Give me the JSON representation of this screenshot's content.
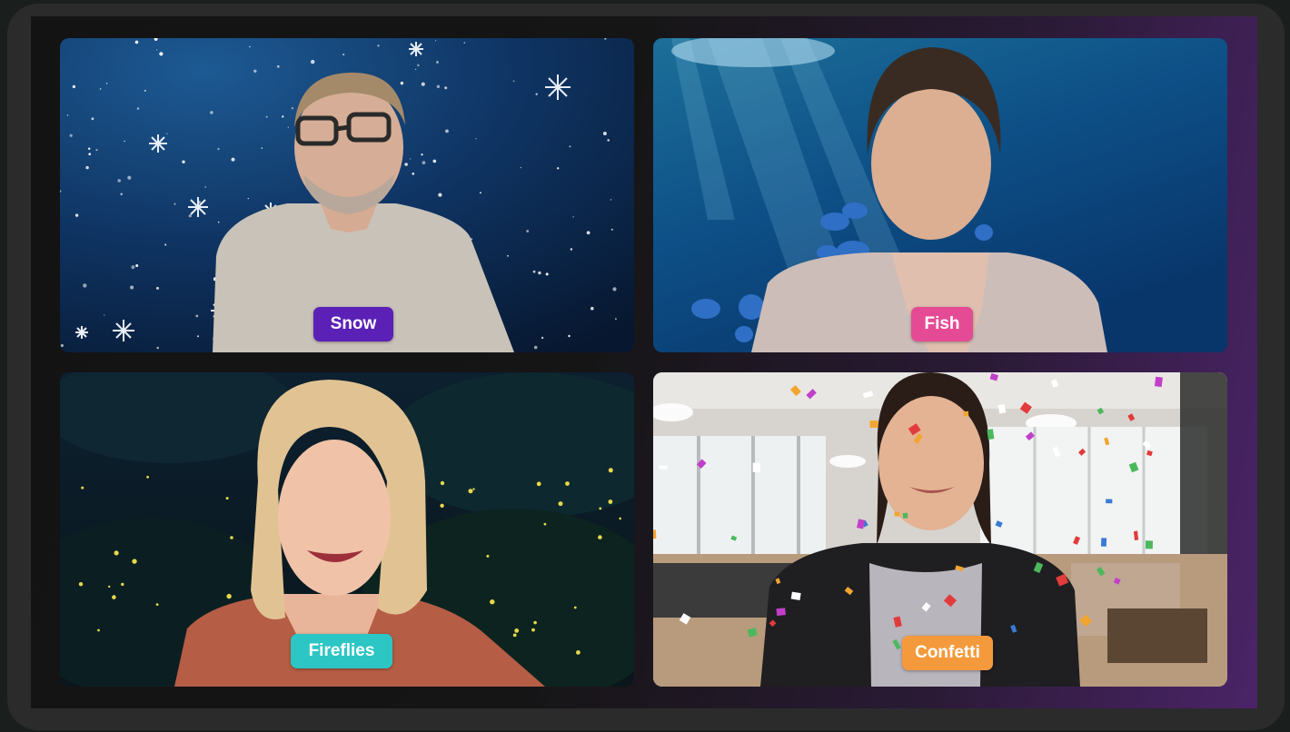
{
  "tiles": [
    {
      "label": "Snow",
      "background": "night-sky-snow",
      "badge_color": "#5b21b6"
    },
    {
      "label": "Fish",
      "background": "underwater",
      "badge_color": "#e54b95"
    },
    {
      "label": "Fireflies",
      "background": "night-forest",
      "badge_color": "#2cc6c4"
    },
    {
      "label": "Confetti",
      "background": "office",
      "badge_color": "#f59a3c"
    }
  ]
}
